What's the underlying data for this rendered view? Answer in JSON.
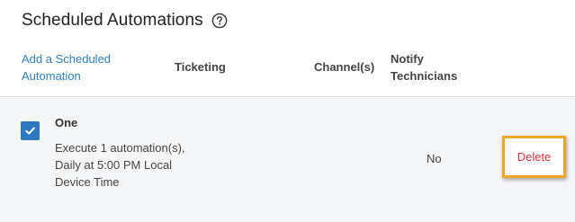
{
  "header": {
    "title": "Scheduled Automations",
    "help_icon": "question-circle-icon"
  },
  "table": {
    "add_link": "Add a Scheduled Automation",
    "columns": {
      "ticketing": "Ticketing",
      "channels": "Channel(s)",
      "notify": "Notify Technicians"
    },
    "rows": [
      {
        "checked": true,
        "name": "One",
        "description": "Execute 1 automation(s), Daily at 5:00 PM Local Device Time",
        "notify_technicians": "No",
        "delete_label": "Delete"
      }
    ]
  },
  "colors": {
    "link": "#2f7fbf",
    "checkbox": "#2e78c2",
    "delete": "#d9343f",
    "highlight": "#f0a623",
    "row_background": "#f5f6f8"
  }
}
